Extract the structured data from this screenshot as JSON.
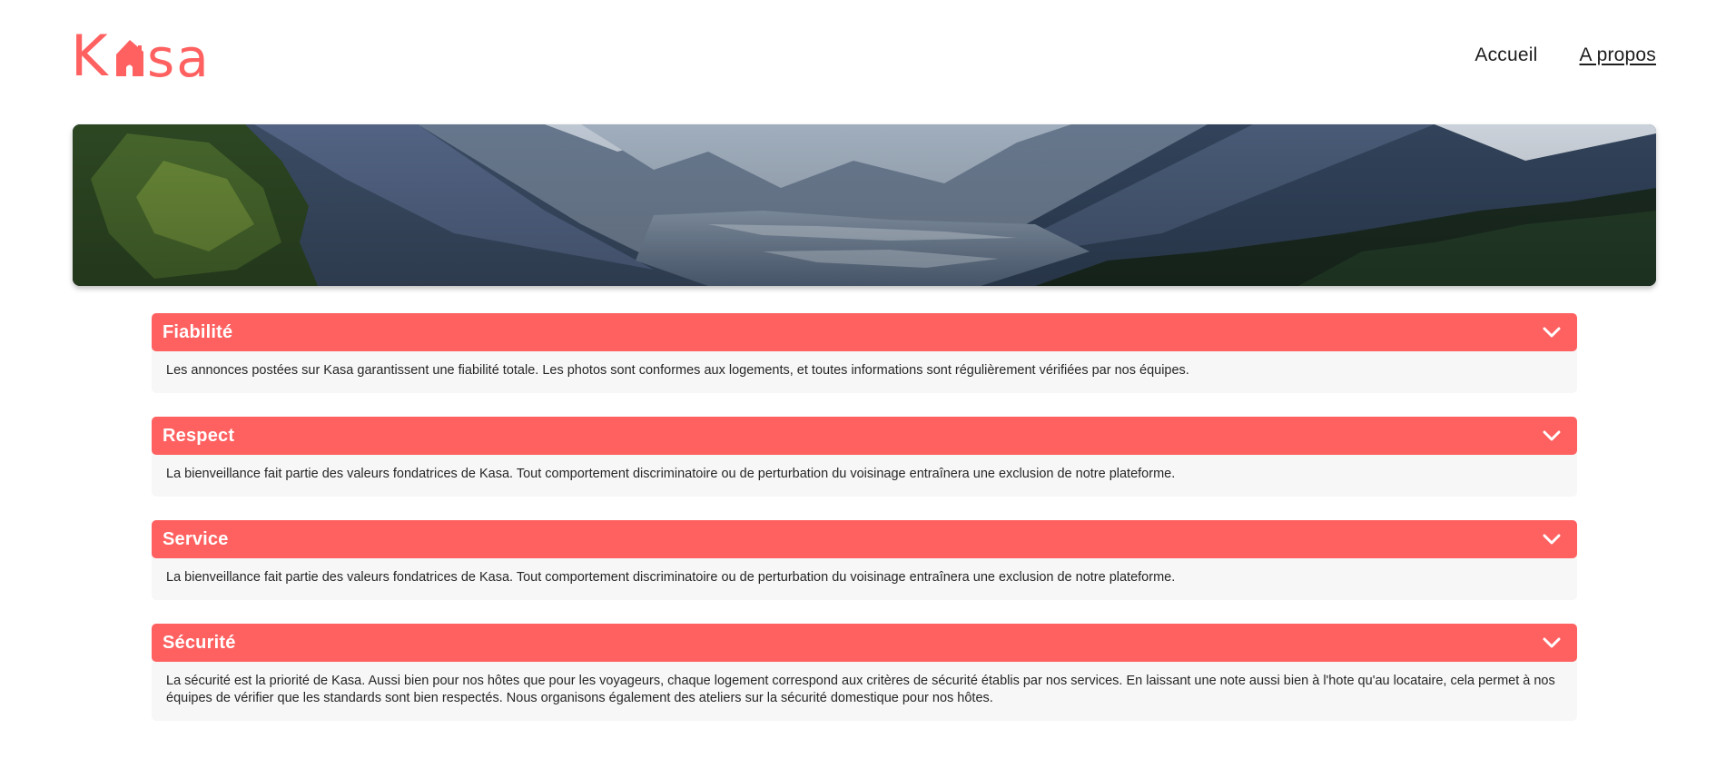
{
  "brand": {
    "logo_text_left": "K",
    "logo_text_right": "sa",
    "color": "#FF6060"
  },
  "nav": {
    "items": [
      {
        "label": "Accueil"
      },
      {
        "label": "A propos"
      }
    ]
  },
  "banner": {
    "alt_icon": "mountain-landscape-image"
  },
  "collapses": [
    {
      "title": "Fiabilité",
      "icon": "chevron-down-icon",
      "content": "Les annonces postées sur Kasa garantissent une fiabilité totale. Les photos sont conformes aux logements, et toutes informations sont régulièrement vérifiées par nos équipes."
    },
    {
      "title": "Respect",
      "icon": "chevron-down-icon",
      "content": "La bienveillance fait partie des valeurs fondatrices de Kasa. Tout comportement discriminatoire ou de perturbation du voisinage entraînera une exclusion de notre plateforme."
    },
    {
      "title": "Service",
      "icon": "chevron-down-icon",
      "content": "La bienveillance fait partie des valeurs fondatrices de Kasa. Tout comportement discriminatoire ou de perturbation du voisinage entraînera une exclusion de notre plateforme."
    },
    {
      "title": "Sécurité",
      "icon": "chevron-down-icon",
      "content": "La sécurité est la priorité de Kasa. Aussi bien pour nos hôtes que pour les voyageurs, chaque logement correspond aux critères de sécurité établis par nos services. En laissant une note aussi bien à l'hote qu'au locataire, cela permet à nos équipes de vérifier que les standards sont bien respectés. Nous organisons également des ateliers sur la sécurité domestique pour nos hôtes."
    }
  ]
}
